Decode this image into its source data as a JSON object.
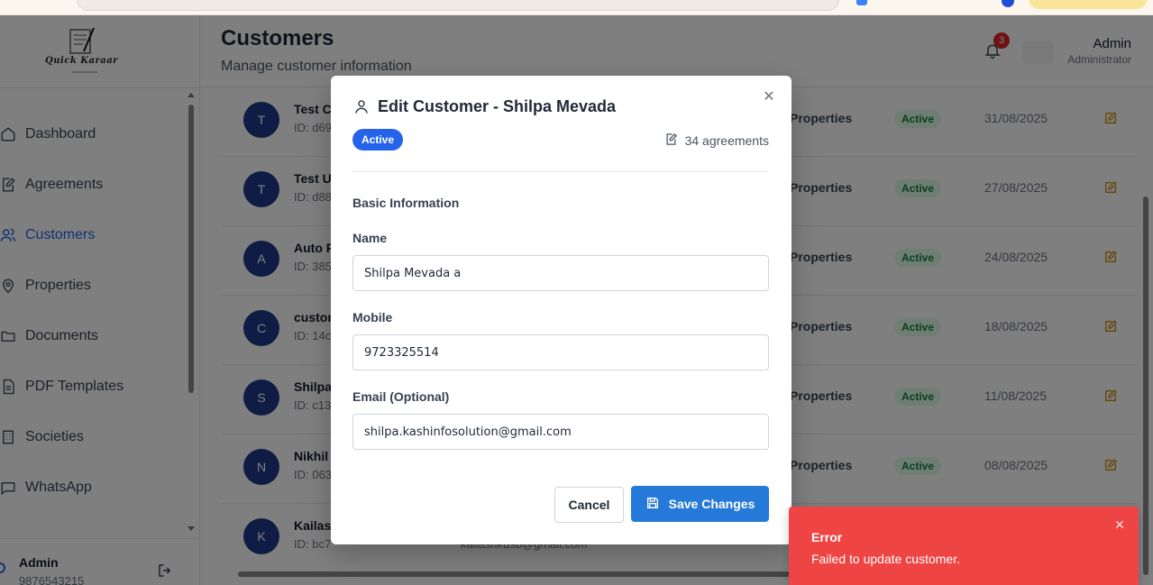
{
  "header": {
    "title": "Customers",
    "subtitle": "Manage customer information",
    "notifications_count": "3",
    "user_name": "Admin",
    "user_role": "Administrator"
  },
  "logo": {
    "text": "Quick Karaar"
  },
  "sidebar": {
    "items": [
      {
        "label": "Dashboard",
        "icon": "home-icon"
      },
      {
        "label": "Agreements",
        "icon": "file-edit-icon"
      },
      {
        "label": "Customers",
        "icon": "users-icon",
        "active": true
      },
      {
        "label": "Properties",
        "icon": "map-pin-icon"
      },
      {
        "label": "Documents",
        "icon": "folder-icon"
      },
      {
        "label": "PDF Templates",
        "icon": "file-text-icon"
      },
      {
        "label": "Societies",
        "icon": "building-icon"
      },
      {
        "label": "WhatsApp",
        "icon": "message-icon"
      }
    ],
    "footer": {
      "name": "Admin",
      "phone": "9876543215"
    }
  },
  "table": {
    "rows": [
      {
        "avatar": "T",
        "name": "Test C",
        "id": "ID: d69",
        "properties": "Properties",
        "status": "Active",
        "date": "31/08/2025"
      },
      {
        "avatar": "T",
        "name": "Test U",
        "id": "ID: d88",
        "properties": "Properties",
        "status": "Active",
        "date": "27/08/2025"
      },
      {
        "avatar": "A",
        "name": "Auto F",
        "id": "ID: 385",
        "properties": "Properties",
        "status": "Active",
        "date": "24/08/2025"
      },
      {
        "avatar": "C",
        "name": "custor",
        "id": "ID: 14c",
        "properties": "Properties",
        "status": "Active",
        "date": "18/08/2025"
      },
      {
        "avatar": "S",
        "name": "Shilpa",
        "id": "ID: c13",
        "properties": "Properties",
        "status": "Active",
        "date": "11/08/2025"
      },
      {
        "avatar": "N",
        "name": "Nikhil",
        "id": "ID: 063",
        "properties": "Properties",
        "status": "Active",
        "date": "08/08/2025"
      },
      {
        "avatar": "K",
        "name": "Kailas",
        "id": "ID: bc7",
        "email": "kailashkusb@gmail.com"
      }
    ]
  },
  "modal": {
    "title": "Edit Customer - Shilpa Mevada",
    "status": "Active",
    "agreements": "34 agreements",
    "section_title": "Basic Information",
    "name_label": "Name",
    "name_value": "Shilpa Mevada a",
    "mobile_label": "Mobile",
    "mobile_value": "9723325514",
    "email_label": "Email (Optional)",
    "email_value": "shilpa.kashinfosolution@gmail.com",
    "cancel_label": "Cancel",
    "save_label": "Save Changes"
  },
  "toast": {
    "title": "Error",
    "message": "Failed to update customer."
  },
  "colors": {
    "primary": "#2579d8",
    "error": "#ef4444",
    "active_badge": "#2563eb"
  }
}
